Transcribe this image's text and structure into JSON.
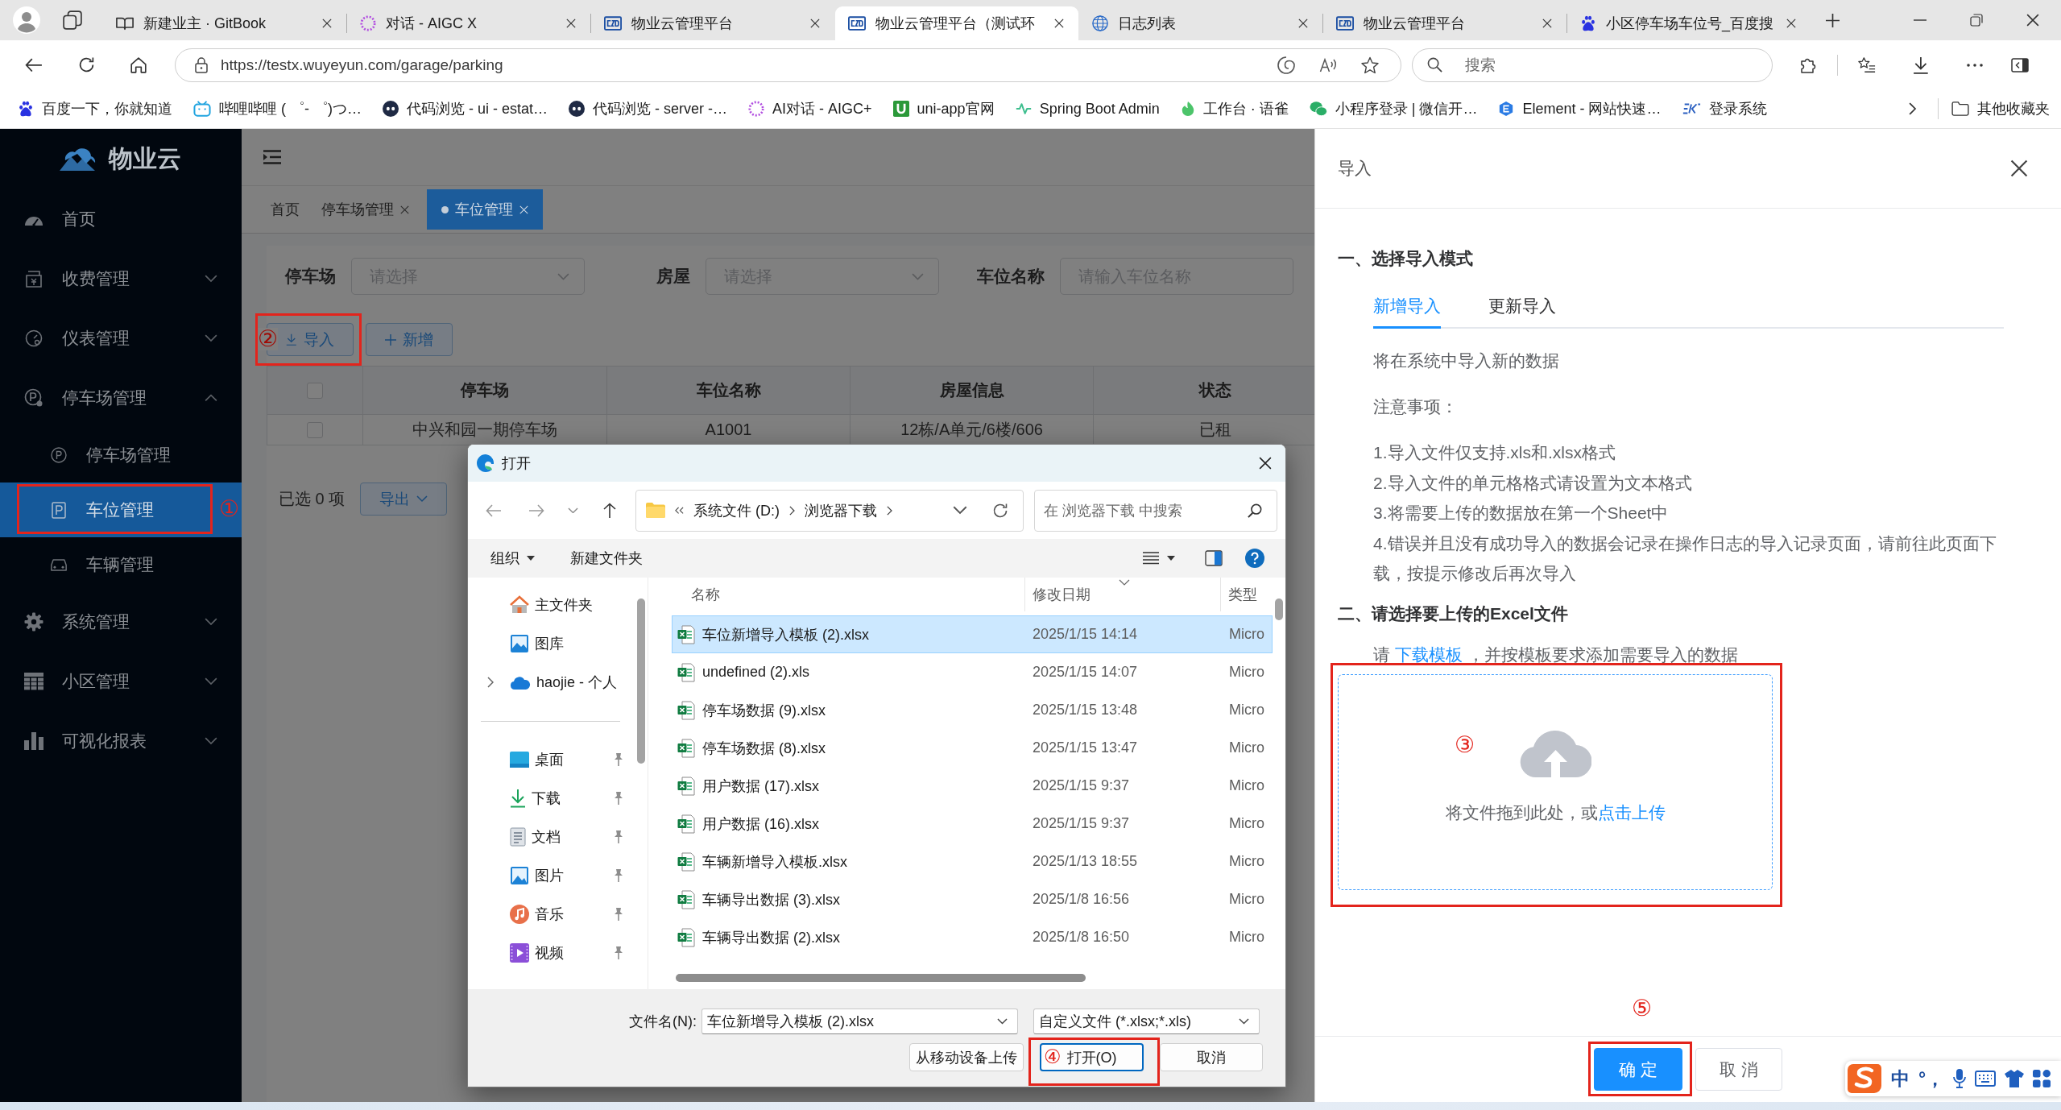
{
  "browser": {
    "tabs": [
      {
        "title": "新建业主 · GitBook",
        "selected": false
      },
      {
        "title": "对话 - AIGC X",
        "selected": false
      },
      {
        "title": "物业云管理平台",
        "selected": false
      },
      {
        "title": "物业云管理平台（测试环",
        "selected": true
      },
      {
        "title": "日志列表",
        "selected": false
      },
      {
        "title": "物业云管理平台",
        "selected": false
      },
      {
        "title": "小区停车场车位号_百度搜",
        "selected": false
      }
    ],
    "address": {
      "url": "https://testx.wuyeyun.com/garage/parking"
    },
    "search": {
      "placeholder": "搜索"
    },
    "bookmarks": [
      {
        "label": "百度一下，你就知道"
      },
      {
        "label": "哔哩哔哩 ( ゜- ゜)つ…"
      },
      {
        "label": "代码浏览 - ui - estat…"
      },
      {
        "label": "代码浏览 - server -…"
      },
      {
        "label": "AI对话 - AIGC+"
      },
      {
        "label": "uni-app官网"
      },
      {
        "label": "Spring Boot Admin"
      },
      {
        "label": "工作台 · 语雀"
      },
      {
        "label": "小程序登录 | 微信开…"
      },
      {
        "label": "Element - 网站快速…"
      },
      {
        "label": "登录系统"
      }
    ],
    "other_bookmarks": "其他收藏夹"
  },
  "sidebar": {
    "logo": "物业云",
    "items": [
      {
        "label": "首页",
        "selected": false
      },
      {
        "label": "收费管理",
        "selected": false,
        "expanded": false
      },
      {
        "label": "仪表管理",
        "selected": false,
        "expanded": false
      },
      {
        "label": "停车场管理",
        "selected": false,
        "expanded": true,
        "children": [
          {
            "label": "停车场管理",
            "selected": false
          },
          {
            "label": "车位管理",
            "selected": true,
            "callout": "①"
          },
          {
            "label": "车辆管理",
            "selected": false
          }
        ]
      },
      {
        "label": "系统管理",
        "selected": false,
        "expanded": false
      },
      {
        "label": "小区管理",
        "selected": false,
        "expanded": false
      },
      {
        "label": "可视化报表",
        "selected": false,
        "expanded": false
      }
    ]
  },
  "header": {
    "tags": [
      {
        "label": "首页",
        "selected": false,
        "closable": false
      },
      {
        "label": "停车场管理",
        "selected": false,
        "closable": true
      },
      {
        "label": "车位管理",
        "selected": true,
        "closable": true
      }
    ]
  },
  "filters": [
    {
      "label": "停车场",
      "kind": "select",
      "placeholder": "请选择"
    },
    {
      "label": "房屋",
      "kind": "select",
      "placeholder": "请选择"
    },
    {
      "label": "车位名称",
      "kind": "input",
      "placeholder": "请输入车位名称"
    }
  ],
  "actions": [
    {
      "label": "导入",
      "kind": "import",
      "callout": "②"
    },
    {
      "label": "新增",
      "kind": "add"
    }
  ],
  "table": {
    "all_checked": false,
    "columns": [
      "停车场",
      "车位名称",
      "房屋信息",
      "状态"
    ],
    "rows": [
      {
        "checked": false,
        "cells": [
          "中兴和园一期停车场",
          "A1001",
          "12栋/A单元/6楼/606",
          "已租"
        ]
      }
    ]
  },
  "table_footer": {
    "selection": "已选 0 项",
    "export": "导出"
  },
  "file_dialog": {
    "title": "打开",
    "path": [
      "系统文件 (D:)",
      "浏览器下载"
    ],
    "search_placeholder": "在 浏览器下载 中搜索",
    "commands": [
      {
        "label": "组织",
        "kind": "menu"
      },
      {
        "label": "新建文件夹",
        "kind": "plain"
      }
    ],
    "nav": [
      {
        "label": "主文件夹"
      },
      {
        "label": "图库"
      },
      {
        "label": "haojie - 个人",
        "expanded": false
      }
    ],
    "quick_access": [
      {
        "label": "桌面",
        "pinned": true
      },
      {
        "label": "下载",
        "pinned": true
      },
      {
        "label": "文档",
        "pinned": true
      },
      {
        "label": "图片",
        "pinned": true
      },
      {
        "label": "音乐",
        "pinned": true
      },
      {
        "label": "视频",
        "pinned": true
      }
    ],
    "columns": [
      "名称",
      "修改日期",
      "类型"
    ],
    "files": [
      {
        "name": "车位新增导入模板 (2).xlsx",
        "date": "2025/1/15 14:14",
        "type": "Micro",
        "selected": true
      },
      {
        "name": "undefined (2).xls",
        "date": "2025/1/15 14:07",
        "type": "Micro",
        "selected": false
      },
      {
        "name": "停车场数据 (9).xlsx",
        "date": "2025/1/15 13:48",
        "type": "Micro",
        "selected": false
      },
      {
        "name": "停车场数据 (8).xlsx",
        "date": "2025/1/15 13:47",
        "type": "Micro",
        "selected": false
      },
      {
        "name": "用户数据 (17).xlsx",
        "date": "2025/1/15 9:37",
        "type": "Micro",
        "selected": false
      },
      {
        "name": "用户数据 (16).xlsx",
        "date": "2025/1/15 9:37",
        "type": "Micro",
        "selected": false
      },
      {
        "name": "车辆新增导入模板.xlsx",
        "date": "2025/1/13 18:55",
        "type": "Micro",
        "selected": false
      },
      {
        "name": "车辆导出数据 (3).xlsx",
        "date": "2025/1/8 16:56",
        "type": "Micro",
        "selected": false
      },
      {
        "name": "车辆导出数据 (2).xlsx",
        "date": "2025/1/8 16:50",
        "type": "Micro",
        "selected": false
      }
    ],
    "filename_label": "文件名(N):",
    "filename": "车位新增导入模板 (2).xlsx",
    "filter": "自定义文件 (*.xlsx;*.xls)",
    "buttons": [
      {
        "label": "从移动设备上传",
        "kind": "secondary"
      },
      {
        "label": "打开(O)",
        "kind": "default",
        "callout": "④"
      },
      {
        "label": "取消",
        "kind": "secondary"
      }
    ]
  },
  "drawer": {
    "title": "导入",
    "mode_heading": "一、选择导入模式",
    "mode_tabs": [
      {
        "label": "新增导入",
        "selected": true
      },
      {
        "label": "更新导入",
        "selected": false
      }
    ],
    "mode_description": "将在系统中导入新的数据",
    "notes_heading": "注意事项：",
    "notes": [
      "1.导入文件仅支持.xls和.xlsx格式",
      "2.导入文件的单元格格式请设置为文本格式",
      "3.将需要上传的数据放在第一个Sheet中",
      "4.错误并且没有成功导入的数据会记录在操作日志的导入记录页面，请前往此页面下载，按提示修改后再次导入"
    ],
    "upload_heading": "二、请选择要上传的Excel文件",
    "template_hint": {
      "before": "请",
      "link": "下载模板",
      "after": "，并按模板要求添加需要导入的数据"
    },
    "dropzone": {
      "text": "将文件拖到此处，或",
      "link": "点击上传",
      "callout": "③"
    },
    "buttons": [
      {
        "label": "确 定",
        "kind": "primary",
        "callout": "⑤"
      },
      {
        "label": "取 消",
        "kind": "plain"
      }
    ]
  },
  "ime_toolbar": {
    "mode": "中",
    "punctuation": "°，"
  }
}
